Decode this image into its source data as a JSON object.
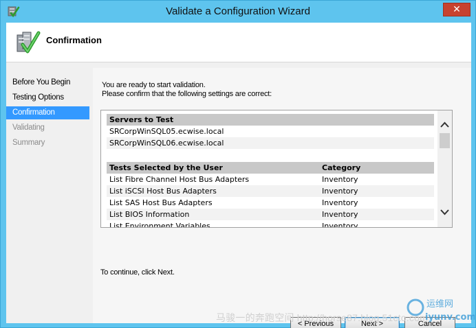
{
  "window": {
    "title": "Validate a Configuration Wizard",
    "close_label": "✕"
  },
  "header": {
    "title": "Confirmation"
  },
  "sidebar": {
    "items": [
      {
        "label": "Before You Begin",
        "state": "normal"
      },
      {
        "label": "Testing Options",
        "state": "normal"
      },
      {
        "label": "Confirmation",
        "state": "active"
      },
      {
        "label": "Validating",
        "state": "disabled"
      },
      {
        "label": "Summary",
        "state": "disabled"
      }
    ]
  },
  "content": {
    "intro_line1": "You are ready to start validation.",
    "intro_line2": "Please confirm that the following settings are correct:",
    "servers_header": "Servers to Test",
    "servers": [
      "SRCorpWinSQL05.ecwise.local",
      "SRCorpWinSQL06.ecwise.local"
    ],
    "tests_header": "Tests Selected by the User",
    "category_header": "Category",
    "tests": [
      {
        "name": "List Fibre Channel Host Bus Adapters",
        "category": "Inventory"
      },
      {
        "name": "List iSCSI Host Bus Adapters",
        "category": "Inventory"
      },
      {
        "name": "List SAS Host Bus Adapters",
        "category": "Inventory"
      },
      {
        "name": "List BIOS Information",
        "category": "Inventory"
      },
      {
        "name": "List Environment Variables",
        "category": "Inventory"
      }
    ],
    "continue_text": "To continue, click Next."
  },
  "buttons": {
    "back": "< Previous",
    "next": "Next >",
    "cancel": "Cancel"
  },
  "watermark": {
    "text": "马骏一的奔跑空间 http://horse87.blog.51cto.com",
    "logo_text": "运维网",
    "logo_sub": "iyunv.com"
  },
  "colors": {
    "title_bar": "#5ec4ee",
    "close_button": "#c7422f",
    "active_nav": "#3399ff",
    "table_header": "#c8c8c8"
  }
}
